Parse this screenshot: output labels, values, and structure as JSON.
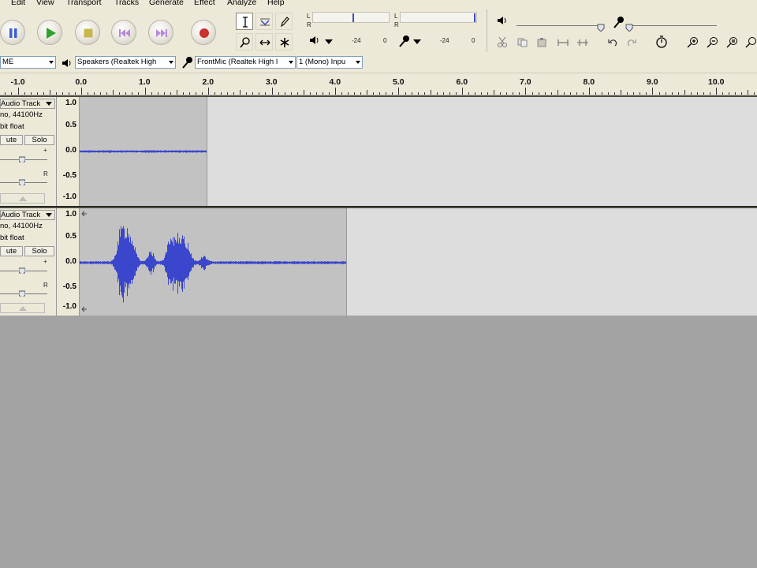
{
  "menu": [
    "Edit",
    "View",
    "Transport",
    "Tracks",
    "Generate",
    "Effect",
    "Analyze",
    "Help"
  ],
  "meters": {
    "playback_ticks": [
      "-24",
      "0"
    ],
    "record_ticks": [
      "-24",
      "0"
    ],
    "L": "L",
    "R": "R"
  },
  "device": {
    "host": "ME",
    "output": "Speakers (Realtek High",
    "input": "FrontMic (Realtek High I",
    "channels": "1 (Mono) Inpu"
  },
  "ruler": {
    "labels": [
      "-1.0",
      "0.0",
      "1.0",
      "2.0",
      "3.0",
      "4.0",
      "5.0",
      "6.0",
      "7.0",
      "8.0",
      "9.0",
      "10.0"
    ]
  },
  "tracks": [
    {
      "name": "Audio Track",
      "rate": "no, 44100Hz",
      "format": "bit float",
      "mute": "ute",
      "solo": "Solo",
      "scale": [
        "1.0",
        "0.5",
        "0.0",
        "-0.5",
        "-1.0"
      ],
      "gain_plus": "+",
      "pan_r": "R",
      "duration_seconds": 2.0
    },
    {
      "name": "Audio Track",
      "rate": "no, 44100Hz",
      "format": "bit float",
      "mute": "ute",
      "solo": "Solo",
      "scale": [
        "1.0",
        "0.5",
        "0.0",
        "-0.5",
        "-1.0"
      ],
      "gain_plus": "+",
      "pan_r": "R",
      "duration_seconds": 4.2
    }
  ],
  "colors": {
    "waveform": "#3a46cc",
    "clip_bg": "#c2c2c2",
    "empty_bg": "#dddddd",
    "workspace": "#a3a3a3",
    "chrome": "#ece9d8"
  }
}
